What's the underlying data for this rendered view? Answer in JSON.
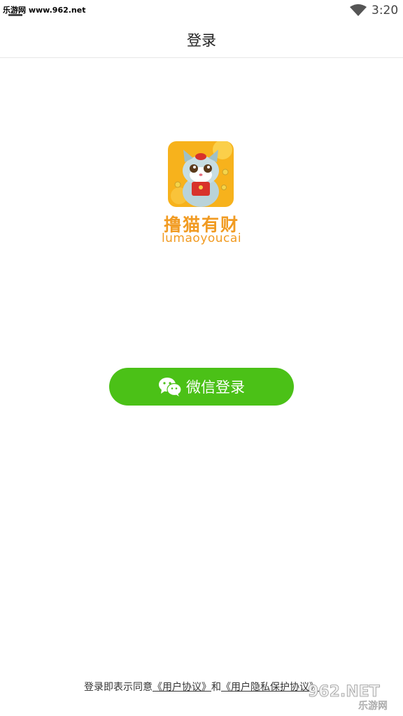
{
  "status_bar": {
    "watermark": "乐游网 www.962.net",
    "time": "3:20"
  },
  "header": {
    "title": "登录"
  },
  "logo": {
    "name": "撸猫有财",
    "subtitle": "lumaoyoucai"
  },
  "login_button": {
    "label": "微信登录"
  },
  "agreement": {
    "prefix": "登录即表示同意",
    "user_agreement": "《用户协议》",
    "conjunction": "和",
    "privacy_policy": "《用户隐私保护协议》"
  },
  "watermark_bottom": {
    "brand": "962.NET",
    "site": "乐游网"
  },
  "colors": {
    "accent": "#4bc117",
    "logo_orange": "#f19b22",
    "logo_bg": "#f7b21c"
  }
}
